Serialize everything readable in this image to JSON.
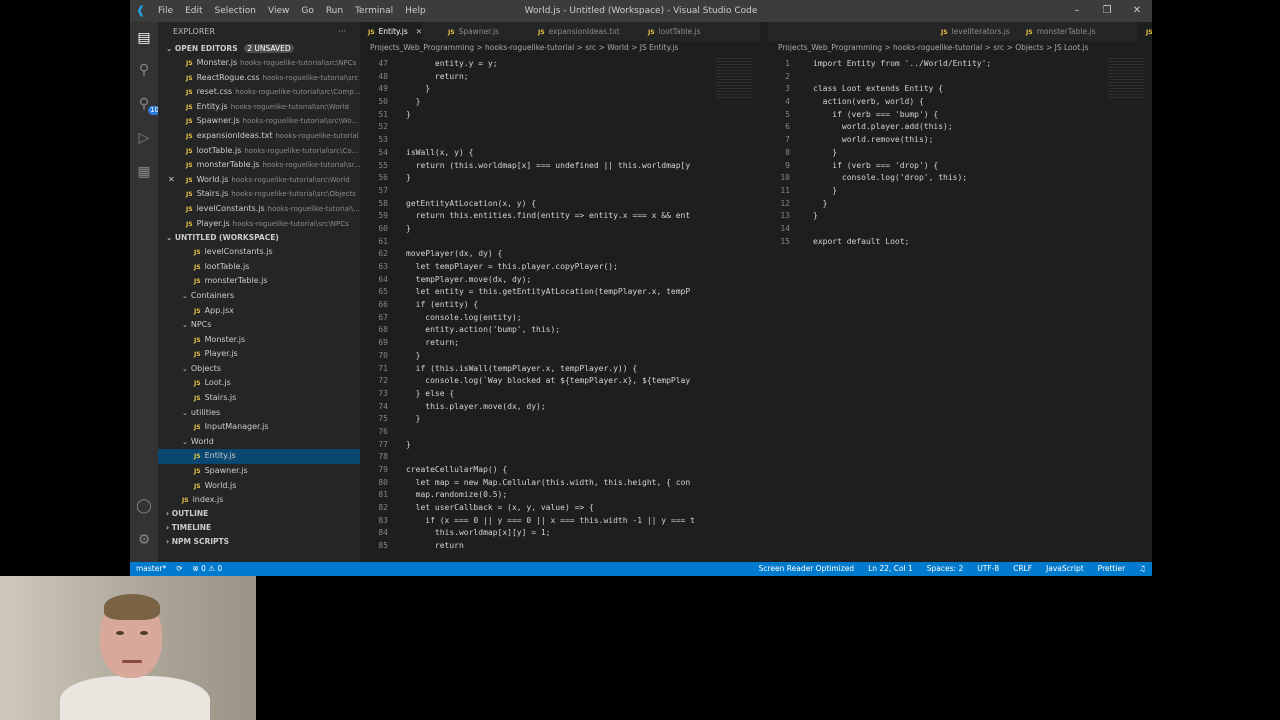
{
  "window": {
    "title": "World.js - Untitled (Workspace) - Visual Studio Code",
    "menu": [
      "File",
      "Edit",
      "Selection",
      "View",
      "Go",
      "Run",
      "Terminal",
      "Help"
    ],
    "controls": [
      "–",
      "❐",
      "✕"
    ]
  },
  "activity_bar": {
    "badge": "10"
  },
  "sidebar": {
    "title": "EXPLORER",
    "open_editors_label": "OPEN EDITORS",
    "unsaved_label": "2 UNSAVED",
    "open_editors": [
      {
        "name": "Monster.js",
        "path": "hooks-roguelike-tutorial\\src\\NPCs"
      },
      {
        "name": "ReactRogue.css",
        "path": "hooks-roguelike-tutorial\\src"
      },
      {
        "name": "reset.css",
        "path": "hooks-roguelike-tutorial\\src\\Comp..."
      },
      {
        "name": "Entity.js",
        "path": "hooks-roguelike-tutorial\\src\\World"
      },
      {
        "name": "Spawner.js",
        "path": "hooks-roguelike-tutorial\\src\\Wo..."
      },
      {
        "name": "expansionIdeas.txt",
        "path": "hooks-roguelike-tutorial"
      },
      {
        "name": "lootTable.js",
        "path": "hooks-roguelike-tutorial\\src\\Co..."
      },
      {
        "name": "monsterTable.js",
        "path": "hooks-roguelike-tutorial\\sr..."
      },
      {
        "name": "World.js",
        "path": "hooks-roguelike-tutorial\\src\\World"
      },
      {
        "name": "Stairs.js",
        "path": "hooks-roguelike-tutorial\\src\\Objects"
      },
      {
        "name": "levelConstants.js",
        "path": "hooks-roguelike-tutorial\\..."
      },
      {
        "name": "Player.js",
        "path": "hooks-roguelike-tutorial\\src\\NPCs"
      }
    ],
    "workspace_label": "UNTITLED (WORKSPACE)",
    "tree": [
      {
        "name": "levelConstants.js",
        "kind": "file",
        "indent": 2
      },
      {
        "name": "lootTable.js",
        "kind": "file",
        "indent": 2
      },
      {
        "name": "monsterTable.js",
        "kind": "file",
        "indent": 2
      },
      {
        "name": "Containers",
        "kind": "folder",
        "indent": 1
      },
      {
        "name": "App.jsx",
        "kind": "file",
        "indent": 2
      },
      {
        "name": "NPCs",
        "kind": "folder",
        "indent": 1
      },
      {
        "name": "Monster.js",
        "kind": "file",
        "indent": 2
      },
      {
        "name": "Player.js",
        "kind": "file",
        "indent": 2
      },
      {
        "name": "Objects",
        "kind": "folder",
        "indent": 1
      },
      {
        "name": "Loot.js",
        "kind": "file",
        "indent": 2
      },
      {
        "name": "Stairs.js",
        "kind": "file",
        "indent": 2
      },
      {
        "name": "utilities",
        "kind": "folder",
        "indent": 1
      },
      {
        "name": "InputManager.js",
        "kind": "file",
        "indent": 2
      },
      {
        "name": "World",
        "kind": "folder",
        "indent": 1
      },
      {
        "name": "Entity.js",
        "kind": "file",
        "indent": 2,
        "selected": true
      },
      {
        "name": "Spawner.js",
        "kind": "file",
        "indent": 2
      },
      {
        "name": "World.js",
        "kind": "file",
        "indent": 2
      },
      {
        "name": "index.js",
        "kind": "file",
        "indent": 1
      }
    ],
    "outline_label": "OUTLINE",
    "timeline_label": "TIMELINE",
    "npm_label": "NPM SCRIPTS"
  },
  "left_editor": {
    "tabs": [
      {
        "label": "Entity.js",
        "active": true
      },
      {
        "label": "Spawner.js",
        "active": false
      },
      {
        "label": "expansionIdeas.txt",
        "active": false
      },
      {
        "label": "lootTable.js",
        "active": false
      }
    ],
    "breadcrumb": "Projects_Web_Programming  >  hooks-roguelike-tutorial  >  src  >  World  >  JS Entity.js",
    "lines": [
      {
        "n": "47",
        "t": "      entity.y = y;"
      },
      {
        "n": "48",
        "t": "      return;"
      },
      {
        "n": "49",
        "t": "    }"
      },
      {
        "n": "50",
        "t": "  }"
      },
      {
        "n": "51",
        "t": "}"
      },
      {
        "n": "52",
        "t": ""
      },
      {
        "n": "53",
        "t": ""
      },
      {
        "n": "54",
        "t": "isWall(x, y) {"
      },
      {
        "n": "55",
        "t": "  return (this.worldmap[x] === undefined || this.worldmap[y"
      },
      {
        "n": "56",
        "t": "}"
      },
      {
        "n": "57",
        "t": ""
      },
      {
        "n": "58",
        "t": "getEntityAtLocation(x, y) {"
      },
      {
        "n": "59",
        "t": "  return this.entities.find(entity => entity.x === x && ent"
      },
      {
        "n": "60",
        "t": "}"
      },
      {
        "n": "61",
        "t": ""
      },
      {
        "n": "62",
        "t": "movePlayer(dx, dy) {"
      },
      {
        "n": "63",
        "t": "  let tempPlayer = this.player.copyPlayer();"
      },
      {
        "n": "64",
        "t": "  tempPlayer.move(dx, dy);"
      },
      {
        "n": "65",
        "t": "  let entity = this.getEntityAtLocation(tempPlayer.x, tempP"
      },
      {
        "n": "66",
        "t": "  if (entity) {"
      },
      {
        "n": "67",
        "t": "    console.log(entity);"
      },
      {
        "n": "68",
        "t": "    entity.action('bump', this);"
      },
      {
        "n": "69",
        "t": "    return;"
      },
      {
        "n": "70",
        "t": "  }"
      },
      {
        "n": "71",
        "t": "  if (this.isWall(tempPlayer.x, tempPlayer.y)) {"
      },
      {
        "n": "72",
        "t": "    console.log(`Way blocked at ${tempPlayer.x}, ${tempPlay"
      },
      {
        "n": "73",
        "t": "  } else {"
      },
      {
        "n": "74",
        "t": "    this.player.move(dx, dy);"
      },
      {
        "n": "75",
        "t": "  }"
      },
      {
        "n": "76",
        "t": ""
      },
      {
        "n": "77",
        "t": "}"
      },
      {
        "n": "78",
        "t": ""
      },
      {
        "n": "79",
        "t": "createCellularMap() {"
      },
      {
        "n": "80",
        "t": "  let map = new Map.Cellular(this.width, this.height, { con"
      },
      {
        "n": "81",
        "t": "  map.randomize(0.5);"
      },
      {
        "n": "82",
        "t": "  let userCallback = (x, y, value) => {"
      },
      {
        "n": "83",
        "t": "    if (x === 0 || y === 0 || x === this.width -1 || y === t"
      },
      {
        "n": "84",
        "t": "      this.worldmap[x][y] = 1;"
      },
      {
        "n": "85",
        "t": "      return"
      }
    ]
  },
  "right_editor": {
    "tabs": [
      {
        "label": "levelIterators.js",
        "active": false
      },
      {
        "label": "monsterTable.js",
        "active": false
      },
      {
        "label": "Loot.js",
        "active": true
      }
    ],
    "breadcrumb": "Projects_Web_Programming  >  hooks-roguelike-tutorial  >  src  >  Objects  >  JS Loot.js",
    "lines": [
      {
        "n": "1",
        "t": "import Entity from '../World/Entity';"
      },
      {
        "n": "2",
        "t": ""
      },
      {
        "n": "3",
        "t": "class Loot extends Entity {"
      },
      {
        "n": "4",
        "t": "  action(verb, world) {"
      },
      {
        "n": "5",
        "t": "    if (verb === 'bump') {"
      },
      {
        "n": "6",
        "t": "      world.player.add(this);"
      },
      {
        "n": "7",
        "t": "      world.remove(this);"
      },
      {
        "n": "8",
        "t": "    }"
      },
      {
        "n": "9",
        "t": "    if (verb === 'drop') {"
      },
      {
        "n": "10",
        "t": "      console.log('drop', this);"
      },
      {
        "n": "11",
        "t": "    }"
      },
      {
        "n": "12",
        "t": "  }"
      },
      {
        "n": "13",
        "t": "}"
      },
      {
        "n": "14",
        "t": ""
      },
      {
        "n": "15",
        "t": "export default Loot;"
      }
    ]
  },
  "status_bar": {
    "branch": "master*",
    "sync": "⟳",
    "problems": "⊗ 0 ⚠ 0",
    "screen_reader": "Screen Reader Optimized",
    "position": "Ln 22, Col 1",
    "spaces": "Spaces: 2",
    "encoding": "UTF-8",
    "eol": "CRLF",
    "language": "JavaScript",
    "formatter": "Prettier"
  },
  "colors": {
    "accent": "#007acc",
    "selection": "#094771"
  }
}
